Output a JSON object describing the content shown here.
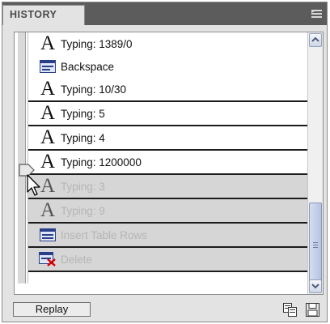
{
  "panel": {
    "title": "HISTORY"
  },
  "history": {
    "items": [
      {
        "label": "Typing: 1389/0",
        "icon": "typing-icon",
        "state": "done"
      },
      {
        "label": "Backspace",
        "icon": "backspace-icon",
        "state": "done"
      },
      {
        "label": "Typing: 10/30",
        "icon": "typing-icon",
        "state": "done"
      },
      {
        "label": "Typing: 5",
        "icon": "typing-icon",
        "state": "done"
      },
      {
        "label": "Typing: 4",
        "icon": "typing-icon",
        "state": "done"
      },
      {
        "label": "Typing: 1200000",
        "icon": "typing-icon",
        "state": "current"
      },
      {
        "label": "Typing: 3",
        "icon": "typing-icon",
        "state": "undone"
      },
      {
        "label": "Typing: 9",
        "icon": "typing-icon",
        "state": "undone"
      },
      {
        "label": "Insert Table Rows",
        "icon": "insert-table-rows-icon",
        "state": "undone"
      },
      {
        "label": "Delete",
        "icon": "delete-icon",
        "state": "undone"
      }
    ]
  },
  "footer": {
    "replay_label": "Replay"
  },
  "colors": {
    "undone_row": "#d6d6d6",
    "scroll_accent": "#b7c4e2",
    "delete_mark": "#d40000"
  }
}
